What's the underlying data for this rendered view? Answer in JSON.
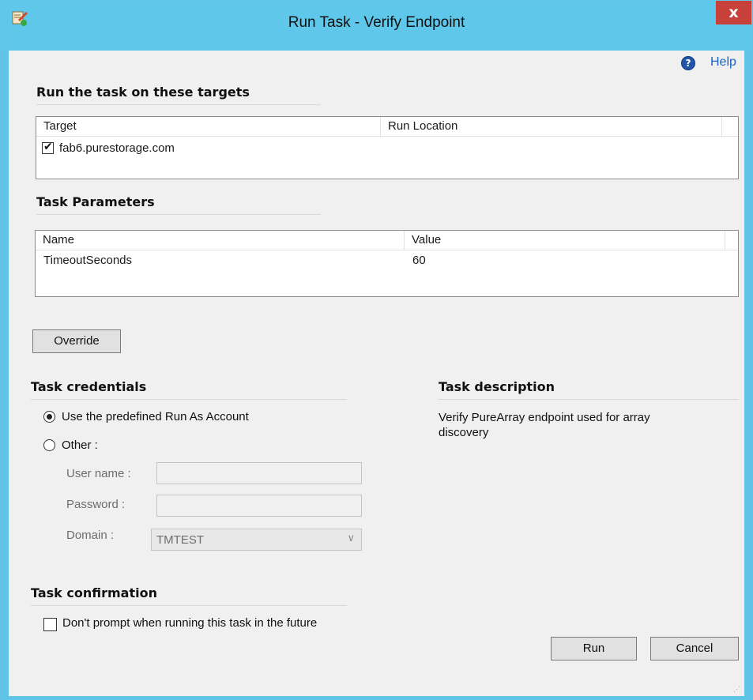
{
  "window": {
    "title": "Run Task - Verify Endpoint",
    "close_label": "x",
    "help_label": "Help"
  },
  "targets": {
    "heading": "Run the task on these targets",
    "columns": [
      "Target",
      "Run Location"
    ],
    "rows": [
      {
        "checked": true,
        "target": "fab6.purestorage.com",
        "run_location": ""
      }
    ]
  },
  "parameters": {
    "heading": "Task Parameters",
    "columns": [
      "Name",
      "Value"
    ],
    "rows": [
      {
        "name": "TimeoutSeconds",
        "value": "60"
      }
    ],
    "override_label": "Override"
  },
  "credentials": {
    "heading": "Task credentials",
    "predefined_label": "Use the predefined Run As Account",
    "predefined_selected": true,
    "other_label": "Other :",
    "username_label": "User name :",
    "username_value": "",
    "password_label": "Password :",
    "password_value": "",
    "domain_label": "Domain :",
    "domain_value": "TMTEST"
  },
  "description": {
    "heading": "Task description",
    "text": "Verify PureArray endpoint used for array discovery"
  },
  "confirmation": {
    "heading": "Task confirmation",
    "dont_prompt_label": "Don't prompt when running this task in the future",
    "dont_prompt_checked": false
  },
  "actions": {
    "run_label": "Run",
    "cancel_label": "Cancel"
  },
  "icons": {
    "app": "task-icon",
    "help": "help-icon",
    "close": "close-icon",
    "dropdown": "chevron-down-icon",
    "check": "checkmark-icon"
  }
}
